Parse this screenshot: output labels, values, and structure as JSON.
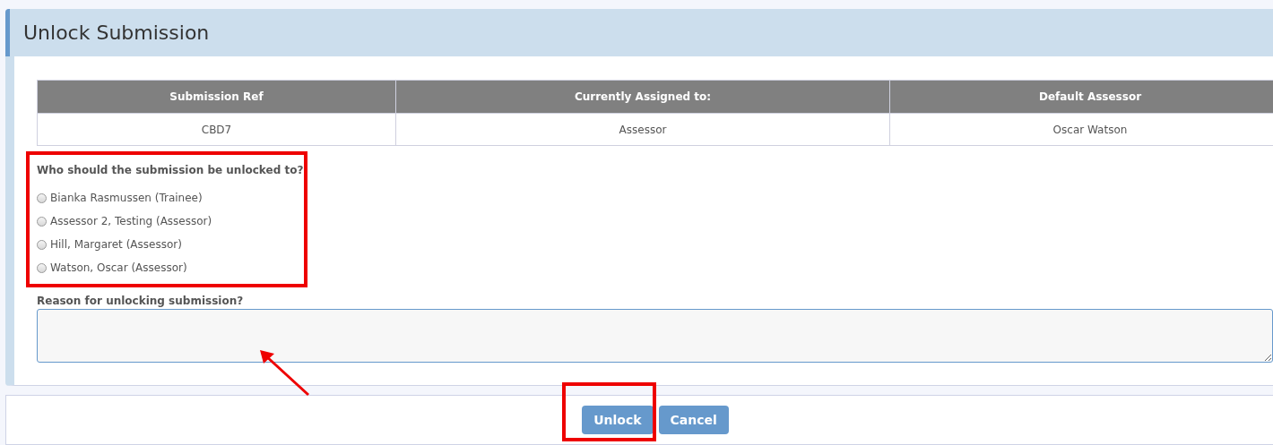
{
  "panel": {
    "title": "Unlock Submission"
  },
  "table": {
    "columns": [
      "Submission Ref",
      "Currently Assigned to:",
      "Default Assessor"
    ],
    "rows": [
      [
        "CBD7",
        "Assessor",
        "Oscar Watson"
      ]
    ]
  },
  "question": {
    "label": "Who should the submission be unlocked to?",
    "options": [
      {
        "label": "Bianka Rasmussen (Trainee)",
        "selected": false
      },
      {
        "label": "Assessor 2, Testing (Assessor)",
        "selected": false
      },
      {
        "label": "Hill, Margaret (Assessor)",
        "selected": false
      },
      {
        "label": "Watson, Oscar (Assessor)",
        "selected": false
      }
    ]
  },
  "reason": {
    "label": "Reason for unlocking submission?"
  },
  "buttons": [
    {
      "label": "Unlock"
    },
    {
      "label": "Cancel"
    }
  ]
}
